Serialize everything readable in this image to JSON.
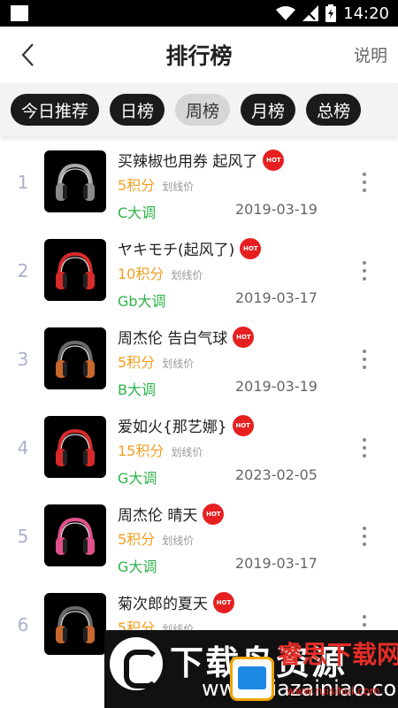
{
  "status_bar": {
    "time": "14:20"
  },
  "header": {
    "title": "排行榜",
    "explain_label": "说明"
  },
  "tabs": [
    {
      "label": "今日推荐",
      "active": false
    },
    {
      "label": "日榜",
      "active": false
    },
    {
      "label": "周榜",
      "active": true
    },
    {
      "label": "月榜",
      "active": false
    },
    {
      "label": "总榜",
      "active": false
    }
  ],
  "hot_label": "HOT",
  "songs": [
    {
      "rank": "1",
      "title": "买辣椒也用券 起风了",
      "price": "5积分",
      "original_price": "划线价",
      "key": "C大调",
      "date": "2019-03-19",
      "cup_color": "#8a8a8a",
      "band_color": "#aaaaaa"
    },
    {
      "rank": "2",
      "title": "ヤキモチ(起风了)",
      "price": "10积分",
      "original_price": "划线价",
      "key": "Gb大调",
      "date": "2019-03-17",
      "cup_color": "#d62a2a",
      "band_color": "#d62a2a"
    },
    {
      "rank": "3",
      "title": "周杰伦 告白气球",
      "price": "5积分",
      "original_price": "划线价",
      "key": "B大调",
      "date": "2019-03-19",
      "cup_color": "#c8682e",
      "band_color": "#6a6a6a"
    },
    {
      "rank": "4",
      "title": "爱如火{那艺娜}",
      "price": "15积分",
      "original_price": "划线价",
      "key": "G大调",
      "date": "2023-02-05",
      "cup_color": "#d62a2a",
      "band_color": "#d62a2a"
    },
    {
      "rank": "5",
      "title": "周杰伦 晴天",
      "price": "5积分",
      "original_price": "划线价",
      "key": "G大调",
      "date": "2019-03-17",
      "cup_color": "#e0508a",
      "band_color": "#e0508a"
    },
    {
      "rank": "6",
      "title": "菊次郎的夏天",
      "price": "5积分",
      "original_price": "划线价",
      "key": "",
      "date": "",
      "cup_color": "#c8682e",
      "band_color": "#6a6a6a"
    }
  ],
  "watermark": {
    "title": "下载鸟资源",
    "url": "www.xiazainiao.com",
    "right_title": "睿思下载网",
    "right_url": "www.ruisihui.com"
  },
  "colors": {
    "price": "#f0a020",
    "key": "#2fb34a",
    "rank": "#aab2cc",
    "hot": "#e62020"
  }
}
